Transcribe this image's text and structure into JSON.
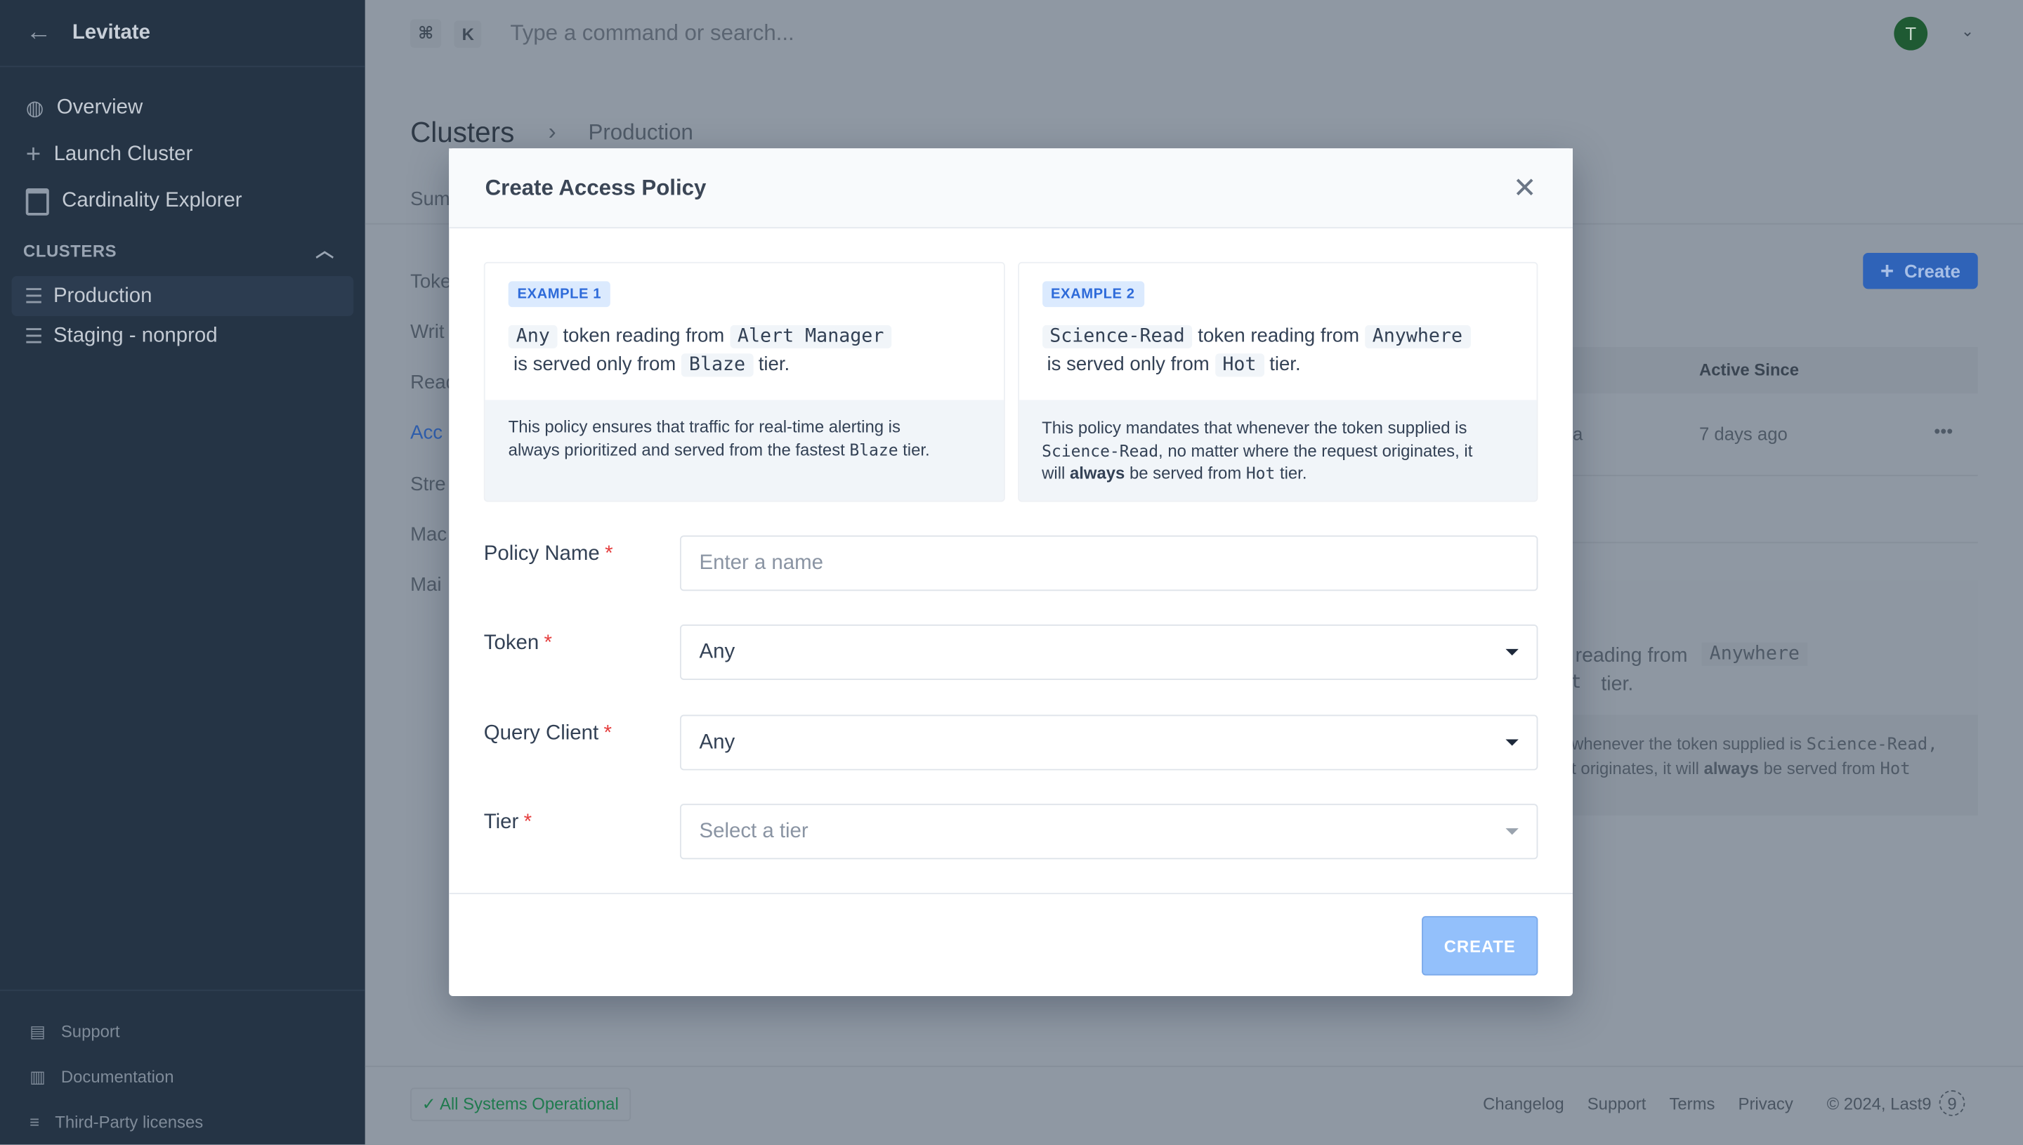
{
  "sidebar": {
    "app_name": "Levitate",
    "nav": [
      {
        "label": "Overview",
        "icon": "globe-search-icon"
      },
      {
        "label": "Launch Cluster",
        "icon": "plus-icon"
      },
      {
        "label": "Cardinality Explorer",
        "icon": "calendar-icon"
      }
    ],
    "clusters_heading": "CLUSTERS",
    "clusters": [
      {
        "label": "Production",
        "active": true
      },
      {
        "label": "Staging - nonprod",
        "active": false
      }
    ],
    "bottom": [
      {
        "label": "Support",
        "icon": "chat-icon"
      },
      {
        "label": "Documentation",
        "icon": "book-icon"
      },
      {
        "label": "Third-Party licenses",
        "icon": "list-icon"
      }
    ]
  },
  "topbar": {
    "kbd_cmd": "⌘",
    "kbd_k": "K",
    "search_placeholder": "Type a command or search...",
    "avatar_initial": "T"
  },
  "background": {
    "breadcrumb": [
      "Clusters",
      "Production"
    ],
    "tab_fragment": "Sum",
    "side_tabs": [
      "Toke",
      "Writ",
      "Read",
      "Acc",
      "Stre",
      "Mac",
      "Mai"
    ],
    "create_label": "Create",
    "table_header": "Active Since",
    "row_fragment": "a",
    "row_active_since": "7 days ago",
    "card_line1": "reading from",
    "card_code1": "Anywhere",
    "card_code2": "t",
    "card_line2": "tier.",
    "card_desc1a": "whenever the token supplied is ",
    "card_desc1b": "Science-Read,",
    "card_desc2a": "t originates, it will ",
    "card_desc2b": "always",
    "card_desc2c": " be served from ",
    "card_desc2d": "Hot"
  },
  "footer": {
    "status": "All Systems Operational",
    "links": [
      "Changelog",
      "Support",
      "Terms",
      "Privacy"
    ],
    "copyright": "© 2024, Last9"
  },
  "modal": {
    "title": "Create Access Policy",
    "examples": [
      {
        "badge": "EXAMPLE 1",
        "token": "Any",
        "t1": "token reading from",
        "client": "Alert Manager",
        "t2": "is served only from",
        "tier": "Blaze",
        "t3": "tier.",
        "desc_a": "This policy ensures that traffic for real-time alerting is",
        "desc_b": "always prioritized and served from the fastest ",
        "desc_code": "Blaze",
        "desc_c": " tier."
      },
      {
        "badge": "EXAMPLE 2",
        "token": "Science-Read",
        "t1": "token reading from",
        "client": "Anywhere",
        "t2": "is served only from",
        "tier": "Hot",
        "t3": "tier.",
        "desc_a": "This policy mandates that whenever the token supplied is",
        "desc_code1": "Science-Read",
        "desc_b": ", no matter where the request originates, it",
        "desc_c": "will ",
        "desc_bold": "always",
        "desc_d": " be served from ",
        "desc_code2": "Hot",
        "desc_e": " tier."
      }
    ],
    "fields": {
      "policy_name": {
        "label": "Policy Name",
        "placeholder": "Enter a name"
      },
      "token": {
        "label": "Token",
        "value": "Any"
      },
      "query_client": {
        "label": "Query Client",
        "value": "Any"
      },
      "tier": {
        "label": "Tier",
        "placeholder": "Select a tier"
      }
    },
    "required_mark": "*",
    "create_label": "CREATE"
  }
}
